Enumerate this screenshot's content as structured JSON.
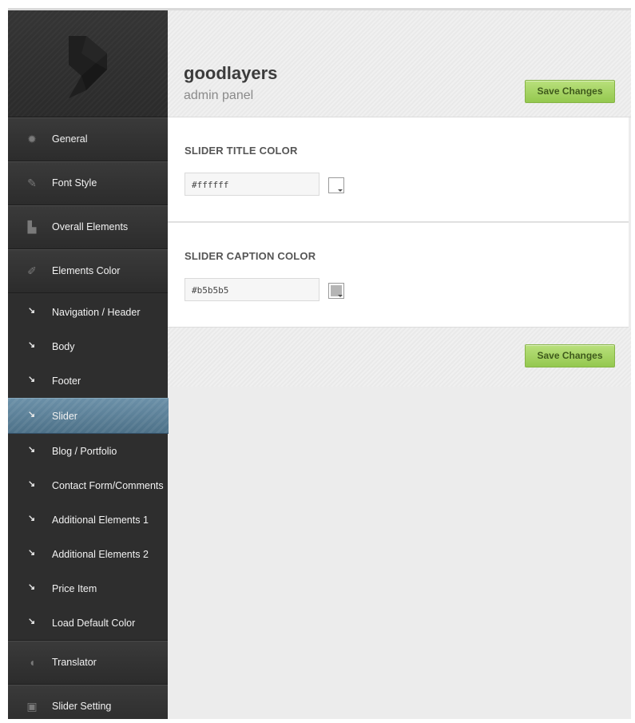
{
  "header": {
    "title": "goodlayers",
    "subtitle": "admin panel",
    "save_label": "Save Changes"
  },
  "sidebar": {
    "top_items": [
      {
        "label": "General",
        "icon": "gear-icon"
      },
      {
        "label": "Font Style",
        "icon": "pencil-icon"
      },
      {
        "label": "Overall Elements",
        "icon": "layout-icon"
      },
      {
        "label": "Elements Color",
        "icon": "brush-icon"
      }
    ],
    "sub_items": [
      {
        "label": "Navigation / Header"
      },
      {
        "label": "Body"
      },
      {
        "label": "Footer"
      },
      {
        "label": "Slider",
        "active": true
      },
      {
        "label": "Blog / Portfolio"
      },
      {
        "label": "Contact Form/Comments"
      },
      {
        "label": "Additional Elements 1"
      },
      {
        "label": "Additional Elements 2"
      },
      {
        "label": "Price Item"
      },
      {
        "label": "Load Default Color"
      }
    ],
    "bottom_items": [
      {
        "label": "Translator",
        "icon": "pacman-icon"
      },
      {
        "label": "Slider Setting",
        "icon": "monitor-icon"
      }
    ],
    "active_color": "#5a7f97"
  },
  "sections": [
    {
      "title": "SLIDER TITLE COLOR",
      "value": "#ffffff",
      "swatch": "#ffffff"
    },
    {
      "title": "SLIDER CAPTION COLOR",
      "value": "#b5b5b5",
      "swatch": "#b5b5b5"
    }
  ],
  "footer": {
    "save_label": "Save Changes"
  },
  "colors": {
    "accent_button": "#a6d465",
    "sidebar_bg": "#2f2f2f"
  }
}
